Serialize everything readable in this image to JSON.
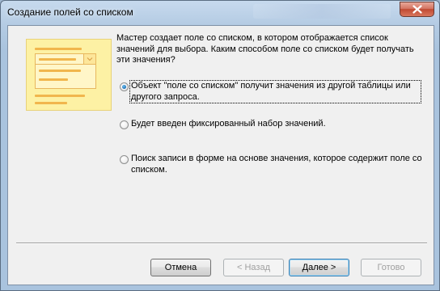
{
  "window": {
    "title": "Создание полей со списком"
  },
  "description": "Мастер создает поле со списком, в котором отображается список значений для выбора.  Каким способом поле со списком будет получать эти значения?",
  "options": [
    {
      "label": "Объект \"поле со списком\" получит значения из другой таблицы или другого запроса.",
      "checked": true
    },
    {
      "label": "Будет введен фиксированный набор значений.",
      "checked": false
    },
    {
      "label": "Поиск записи в форме на основе значения, которое содержит поле со списком.",
      "checked": false
    }
  ],
  "buttons": {
    "cancel": "Отмена",
    "back": "< Назад",
    "next": "Далее >",
    "finish": "Готово"
  },
  "icons": {
    "close": "close-icon",
    "illustration": "combo-box-illustration"
  },
  "colors": {
    "illustration_bg": "#fdf1a4",
    "illustration_bars": "#f1b64d",
    "close_button": "#c04a32"
  }
}
